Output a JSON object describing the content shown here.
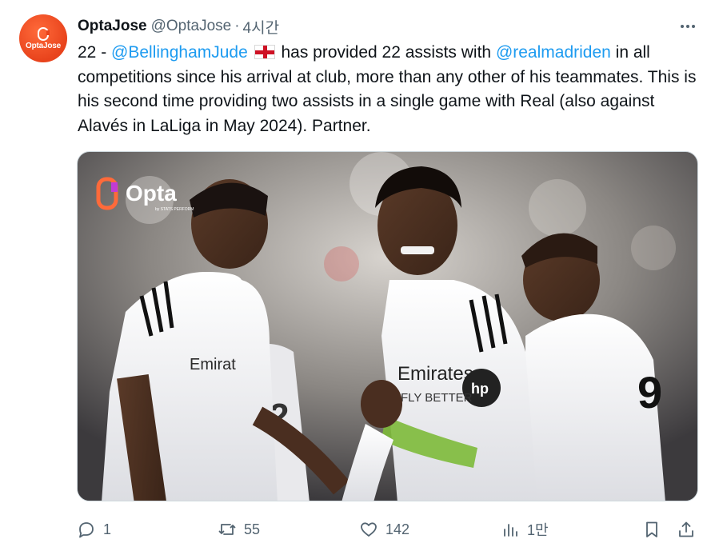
{
  "tweet": {
    "avatar_text": "OptaJose",
    "author_name": "OptaJose",
    "author_handle": "@OptaJose",
    "separator": "·",
    "time": "4시간",
    "text": {
      "prefix": "22 - ",
      "mention_player": "@BellinghamJude",
      "flag_icon": "england-flag-icon",
      "middle": " has provided 22 assists with ",
      "mention_club": "@realmadriden",
      "suffix": " in all competitions since his arrival at club, more than any other of his teammates. This is his second time providing two assists in a single game with Real (also against Alavés in LaLiga in May 2024). Partner."
    },
    "media": {
      "watermark_brand": "Opta",
      "watermark_sub": "by STATS PERFORM",
      "jersey_sponsor": "Emirates",
      "jersey_sponsor_line2": "FLY BETTER",
      "jersey_number": "9"
    },
    "actions": {
      "reply_count": "1",
      "retweet_count": "55",
      "like_count": "142",
      "views_count": "1만",
      "reply_icon": "reply-icon",
      "retweet_icon": "retweet-icon",
      "like_icon": "heart-icon",
      "views_icon": "views-icon",
      "bookmark_icon": "bookmark-icon",
      "share_icon": "share-icon"
    },
    "colors": {
      "link": "#1d9bf0",
      "secondary_text": "#536471",
      "avatar_bg": "#e8431c"
    }
  }
}
